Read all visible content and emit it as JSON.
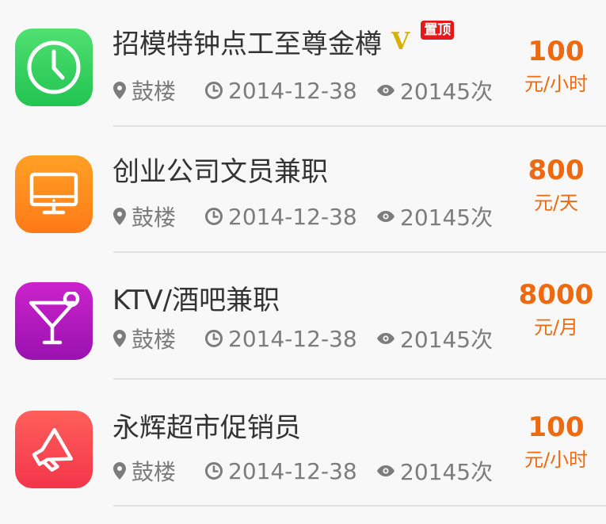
{
  "jobs": [
    {
      "title": "招模特钟点工至尊金樽",
      "vip_badge": "V",
      "top_badge": "置顶",
      "location": "鼓楼",
      "date": "2014-12-38",
      "views": "20145次",
      "price": "100",
      "unit": "元/小时",
      "icon": "clock-icon",
      "icon_color": "#3fd160"
    },
    {
      "title": "创业公司文员兼职",
      "location": "鼓楼",
      "date": "2014-12-38",
      "views": "20145次",
      "price": "800",
      "unit": "元/天",
      "icon": "monitor-icon",
      "icon_color": "#ff8a1c"
    },
    {
      "title": "KTV/酒吧兼职",
      "location": "鼓楼",
      "date": "2014-12-38",
      "views": "20145次",
      "price": "8000",
      "unit": "元/月",
      "icon": "cocktail-icon",
      "icon_color": "#b51bc0"
    },
    {
      "title": "永辉超市促销员",
      "location": "鼓楼",
      "date": "2014-12-38",
      "views": "20145次",
      "price": "100",
      "unit": "元/小时",
      "icon": "megaphone-icon",
      "icon_color": "#ff4a52"
    }
  ],
  "colors": {
    "price": "#ee6a10",
    "meta": "#7c7c7c",
    "title": "#333333",
    "divider": "#e0e0e0",
    "vip": "#d8b100",
    "top_badge": "#e4171b"
  }
}
